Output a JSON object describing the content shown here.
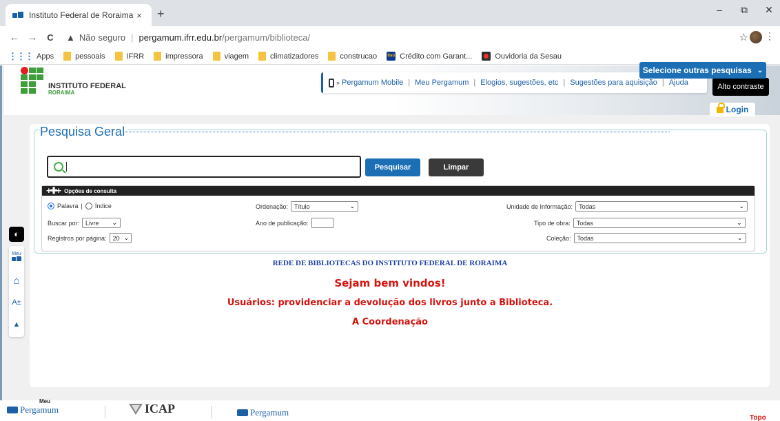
{
  "browser": {
    "tab_title": "Instituto Federal de Roraima",
    "tab_close": "×",
    "new_tab": "+",
    "minimize": "–",
    "restore": "⧉",
    "close": "✕",
    "back": "←",
    "forward": "→",
    "reload": "C",
    "security_label": "Não seguro",
    "url_host": "pergamum.ifrr.edu.br",
    "url_path": "/pergamum/biblioteca/",
    "bookmarks": [
      "Apps",
      "pessoais",
      "IFRR",
      "impressora",
      "viagem",
      "climatizadores",
      "construcao",
      "Crédito com Garant...",
      "Ouvidoria da Sesau"
    ]
  },
  "header": {
    "logo_name": "INSTITUTO FEDERAL",
    "logo_sub": "RORAIMA",
    "nav": [
      "Pergamum Mobile",
      "Meu Pergamum",
      "Elogios, sugestões, etc",
      "Sugestões para aquisição",
      "Ajuda"
    ],
    "contrast_button": "Alto contraste",
    "login_button": "Login"
  },
  "sidebar": {
    "contrast_icon": "◐",
    "items": [
      "Meu",
      "⌂",
      "A±",
      "▲"
    ]
  },
  "search": {
    "legend": "Pesquisa Geral",
    "other_searches": "Selecione outras pesquisas",
    "pesquisar": "Pesquisar",
    "limpar": "Limpar",
    "options_title": "Opções de consulta",
    "radio_palavra": "Palavra",
    "radio_indice": "Índice",
    "buscar_por_label": "Buscar por:",
    "buscar_por_value": "Livre",
    "registros_label": "Registros por página:",
    "registros_value": "20",
    "ordenacao_label": "Ordenação:",
    "ordenacao_value": "Título",
    "ano_label": "Ano de publicação:",
    "unidade_label": "Unidade de Informação:",
    "unidade_value": "Todas",
    "tipo_label": "Tipo de obra:",
    "tipo_value": "Todas",
    "colecao_label": "Coleção:",
    "colecao_value": "Todas"
  },
  "messages": {
    "rede": "REDE DE BIBLIOTECAS DO INSTITUTO FEDERAL DE RORAIMA",
    "welcome": "Sejam bem vindos!",
    "notice": "Usuários: providenciar a devolução dos livros junto a Biblioteca.",
    "signature": "A Coordenação"
  },
  "footer": {
    "meu_pergamum_top": "Meu",
    "meu_pergamum": "Pergamum",
    "icap": "ICAP",
    "pergamum": "Pergamum",
    "topo": "Topo"
  },
  "colors": {
    "brand_blue": "#1c6fb5",
    "message_red": "#d6140f",
    "ifrr_green": "#3f9e3c"
  }
}
